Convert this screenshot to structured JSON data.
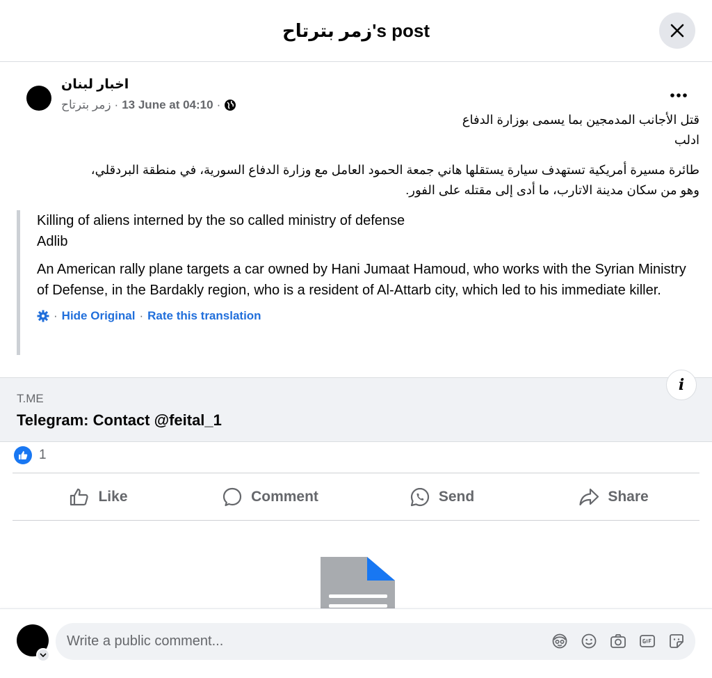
{
  "header": {
    "title": "زمر بترتاح's post",
    "close_icon": "close-icon"
  },
  "post": {
    "page_name": "اخبار لبنان",
    "author": "زمر بترتاح",
    "timestamp": "13 June at 04:10",
    "separator": "·",
    "audience_icon": "globe-icon",
    "more_icon": "more-options-icon",
    "arabic_lines": {
      "line1": "قتل الأجانب المدمجين بما يسمى  بوزارة الدفاع",
      "line2": "ادلب",
      "line3": "طائرة مسيرة أمريكية تستهدف سيارة يستقلها هاني جمعة الحمود العامل مع وزارة الدفاع السورية، في منطقة البردقلي،",
      "line4": "وهو من سكان مدينة الاتارب، ما أدى إلى مقتله على الفور."
    },
    "translation": {
      "line1": "Killing of aliens interned by the so called ministry of defense",
      "line2": "Adlib",
      "paragraph": "An American rally plane targets a car owned by Hani Jumaat Hamoud, who works with the Syrian Ministry of Defense, in the Bardakly region, who is a resident of Al-Attarb city, which led to his immediate killer.",
      "settings_icon": "gear-icon",
      "hide_original": "Hide Original",
      "rate": "Rate this translation",
      "separator": "·"
    },
    "link_card": {
      "domain": "T.ME",
      "title": "Telegram: Contact @feital_1",
      "info_label": "i"
    },
    "reactions": {
      "count": "1",
      "icon": "like-reaction-icon"
    },
    "actions": {
      "like": "Like",
      "comment": "Comment",
      "send": "Send",
      "share": "Share"
    }
  },
  "composer": {
    "placeholder": "Write a public comment...",
    "tools": [
      "avatar-sticker-icon",
      "emoji-icon",
      "camera-icon",
      "gif-icon",
      "sticker-icon"
    ]
  },
  "colors": {
    "accent": "#1877f2",
    "link_text": "#216fdb",
    "secondary_text": "#65676b",
    "card_bg": "#f0f2f5"
  }
}
